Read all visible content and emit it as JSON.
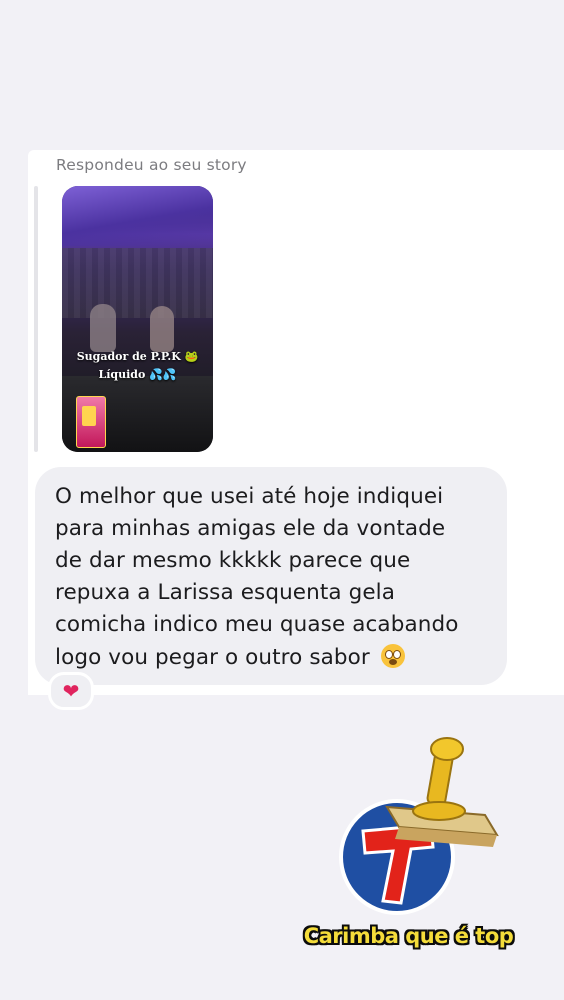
{
  "story_reply": {
    "label": "Respondeu ao seu story",
    "thumbnail_caption_line1": "Sugador de P.P.K 🐸",
    "thumbnail_caption_line2": "Líquido 💦💦"
  },
  "message": {
    "lines": [
      "O melhor que usei até hoje indiquei",
      "para minhas amigas ele da vontade",
      "de dar mesmo kkkkk parece que",
      "repuxa a Larissa esquenta gela",
      "comicha indico meu quase acabando",
      "logo vou pegar o outro sabor"
    ],
    "trailing_emoji": "flushed-face-icon",
    "reaction": "❤",
    "reaction_icon": "heart-icon"
  },
  "sticker": {
    "caption": "Carimba que é top",
    "letter": "T",
    "colors": {
      "circle_blue": "#1f4fa3",
      "letter_red": "#e2231a",
      "handle_gold": "#e8b820",
      "caption_yellow": "#f4dc3a"
    }
  }
}
